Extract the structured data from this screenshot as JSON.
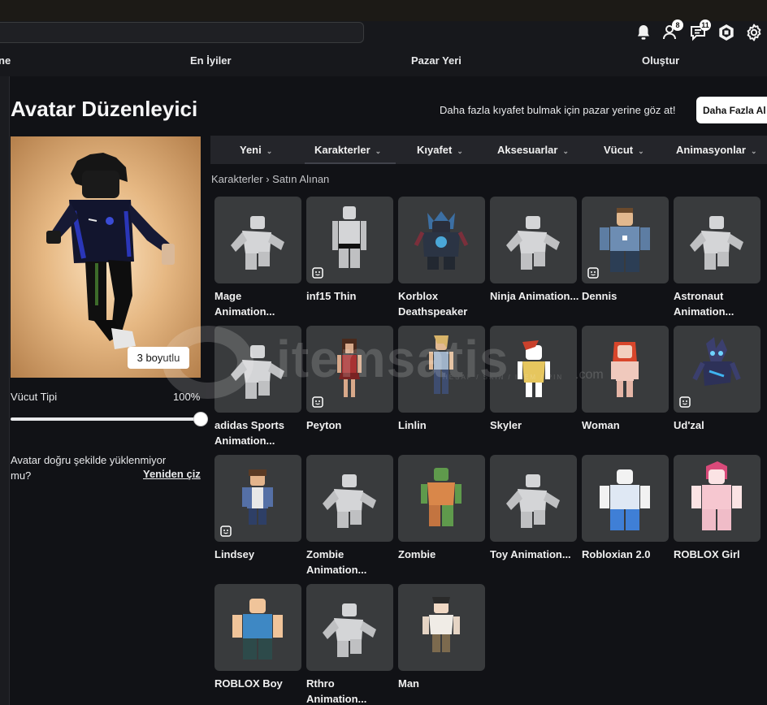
{
  "header": {
    "nav": [
      "ne",
      "En İyiler",
      "Pazar Yeri",
      "Oluştur"
    ],
    "icons": [
      {
        "name": "bell-icon",
        "badge": ""
      },
      {
        "name": "friends-icon",
        "badge": "8"
      },
      {
        "name": "chat-icon",
        "badge": "11"
      },
      {
        "name": "robux-icon",
        "badge": ""
      },
      {
        "name": "gear-icon",
        "badge": ""
      }
    ]
  },
  "page": {
    "title": "Avatar Düzenleyici",
    "promo_text": "Daha fazla kıyafet bulmak için pazar yerine göz at!",
    "promo_button": "Daha Fazla Al"
  },
  "avatar": {
    "view_button": "3 boyutlu",
    "body_type_label": "Vücut Tipi",
    "body_type_value": "100%",
    "body_type_level": 1.0,
    "load_message": "Avatar doğru şekilde yüklenmiyor mu?",
    "redraw_link": "Yeniden çiz"
  },
  "categories": [
    "Yeni",
    "Karakterler",
    "Kıyafet",
    "Aksesuarlar",
    "Vücut",
    "Animasyonlar"
  ],
  "selected_category": "Karakterler",
  "breadcrumb": {
    "root": "Karakterler",
    "sep": "›",
    "current": "Satın Alınan"
  },
  "watermark": {
    "text": "itemsatis",
    "sub": "HESAP / SKIN / ITEM / PIN",
    "suffix": ".com"
  },
  "items": [
    {
      "name": "Mage Animation...",
      "kind": "anim",
      "badge": false
    },
    {
      "name": "inf15 Thin",
      "kind": "thin",
      "badge": true
    },
    {
      "name": "Korblox Deathspeaker",
      "kind": "korblox",
      "badge": false
    },
    {
      "name": "Ninja Animation...",
      "kind": "anim",
      "badge": false
    },
    {
      "name": "Dennis",
      "kind": "dennis",
      "badge": true
    },
    {
      "name": "Astronaut Animation...",
      "kind": "anim",
      "badge": false
    },
    {
      "name": "adidas Sports Animation...",
      "kind": "anim",
      "badge": false
    },
    {
      "name": "Peyton",
      "kind": "peyton",
      "badge": true
    },
    {
      "name": "Linlin",
      "kind": "linlin",
      "badge": false
    },
    {
      "name": "Skyler",
      "kind": "skyler",
      "badge": false
    },
    {
      "name": "Woman",
      "kind": "woman",
      "badge": false
    },
    {
      "name": "Ud'zal",
      "kind": "udzal",
      "badge": true
    },
    {
      "name": "Lindsey",
      "kind": "lindsey",
      "badge": true
    },
    {
      "name": "Zombie Animation...",
      "kind": "anim",
      "badge": false
    },
    {
      "name": "Zombie",
      "kind": "zombie",
      "badge": false
    },
    {
      "name": "Toy Animation...",
      "kind": "anim",
      "badge": false
    },
    {
      "name": "Robloxian 2.0",
      "kind": "robloxian",
      "badge": false
    },
    {
      "name": "ROBLOX Girl",
      "kind": "girl",
      "badge": false
    },
    {
      "name": "ROBLOX Boy",
      "kind": "boy",
      "badge": false
    },
    {
      "name": "Rthro Animation...",
      "kind": "anim",
      "badge": false
    },
    {
      "name": "Man",
      "kind": "man",
      "badge": false
    }
  ],
  "colors": {
    "background": "#111216",
    "card": "#393b3d",
    "header": "#17181c",
    "category_bar": "#24252a"
  }
}
